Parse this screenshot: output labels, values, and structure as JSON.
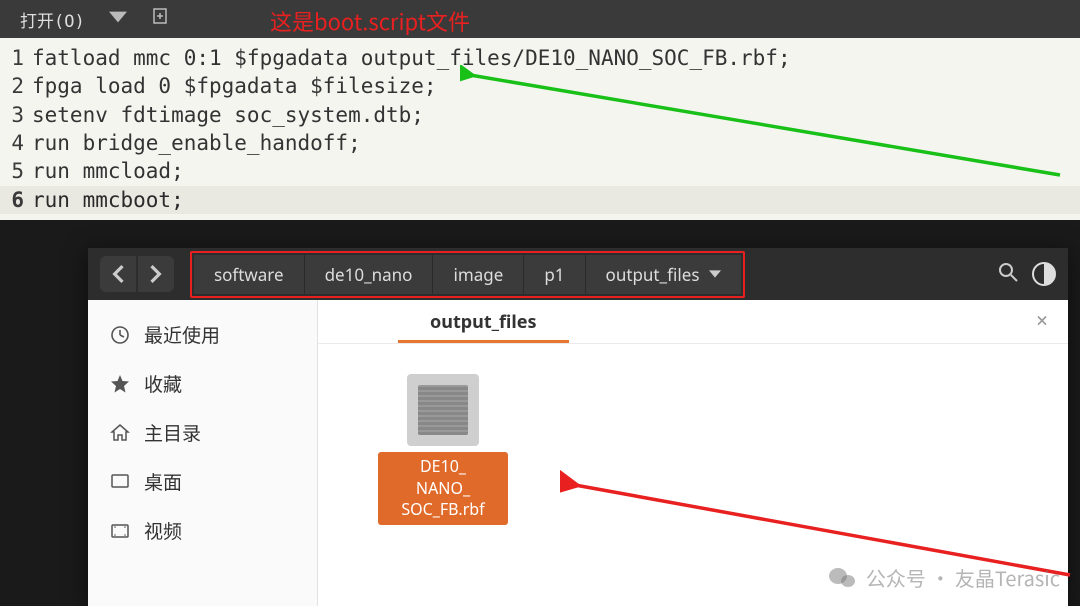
{
  "editor": {
    "toolbar": {
      "open_label": "打开(O)"
    },
    "annotation": "这是boot.script文件",
    "lines": [
      "fatload mmc 0:1 $fpgadata output_files/DE10_NANO_SOC_FB.rbf;",
      "fpga load 0 $fpgadata $filesize;",
      "setenv fdtimage soc_system.dtb;",
      "run bridge_enable_handoff;",
      "run mmcload;",
      "run mmcboot;"
    ]
  },
  "file_manager": {
    "breadcrumbs": [
      "software",
      "de10_nano",
      "image",
      "p1",
      "output_files"
    ],
    "sidebar": [
      "最近使用",
      "收藏",
      "主目录",
      "桌面",
      "视频"
    ],
    "active_tab": "output_files",
    "files": [
      {
        "name": "DE10_\nNANO_\nSOC_FB.rbf"
      }
    ]
  },
  "watermark": "公众号 · 友晶Terasic"
}
